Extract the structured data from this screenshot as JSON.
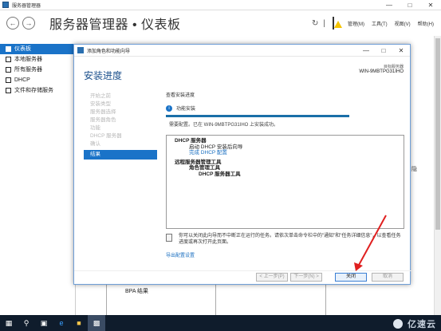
{
  "window": {
    "title": "服务器管理器",
    "controls": [
      "—",
      "□",
      "✕"
    ]
  },
  "toolbar": {
    "breadcrumb": "服务器管理器 • 仪表板",
    "menu": [
      "管理(M)",
      "工具(T)",
      "视图(V)",
      "帮助(H)"
    ]
  },
  "sidebar": {
    "items": [
      {
        "label": "仪表板",
        "active": true
      },
      {
        "label": "本地服务器",
        "active": false
      },
      {
        "label": "所有服务器",
        "active": false
      },
      {
        "label": "DHCP",
        "active": false
      },
      {
        "label": "文件和存储服务",
        "active": false
      }
    ]
  },
  "background": {
    "bpa_label": "BPA 结果",
    "side_mark": "隐"
  },
  "dialog": {
    "title": "添加角色和功能向导",
    "controls": [
      "—",
      "□",
      "✕"
    ],
    "heading": "安装进度",
    "server_label": "目标服务器",
    "server_name": "WIN-9MBTPG31IHO",
    "steps": [
      "开始之前",
      "安装类型",
      "服务器选择",
      "服务器角色",
      "功能",
      "DHCP 服务器",
      "确认",
      "结果"
    ],
    "active_step": 7,
    "view_progress": "查看安装进度",
    "install_status": "功能安装",
    "progress": 1.0,
    "success_text": "需要配置。已在 WIN-9MBTPG31IHO 上安装成功。",
    "results": [
      {
        "text": "DHCP 服务器",
        "style": "bold ind1"
      },
      {
        "text": "启动 DHCP 安装后向导",
        "style": "ind2"
      },
      {
        "text": "完成 DHCP 配置",
        "style": "ind2 link"
      },
      {
        "text": "远程服务器管理工具",
        "style": "bold ind1 gap"
      },
      {
        "text": "角色管理工具",
        "style": "bold ind2"
      },
      {
        "text": "DHCP 服务器工具",
        "style": "bold ind3"
      }
    ],
    "note": "你可以关闭此向导而不中断正在运行的任务。请依次单击命令栏中的\"通知\"和\"任务详细信息\"，以查看任务进度或再次打开此页面。",
    "export_link": "导出配置设置",
    "buttons": {
      "prev": "< 上一步(P)",
      "next": "下一步(N) >",
      "close": "关闭",
      "cancel": "取消"
    }
  },
  "taskbar": {
    "items": [
      "start-icon",
      "search-icon",
      "task-view-icon",
      "edge-icon",
      "file-explorer-icon",
      "server-manager-icon"
    ],
    "watermark": "亿速云"
  },
  "colors": {
    "accent": "#1a73c8",
    "arrow": "#e02020",
    "taskbar": "#0f1c2c"
  }
}
